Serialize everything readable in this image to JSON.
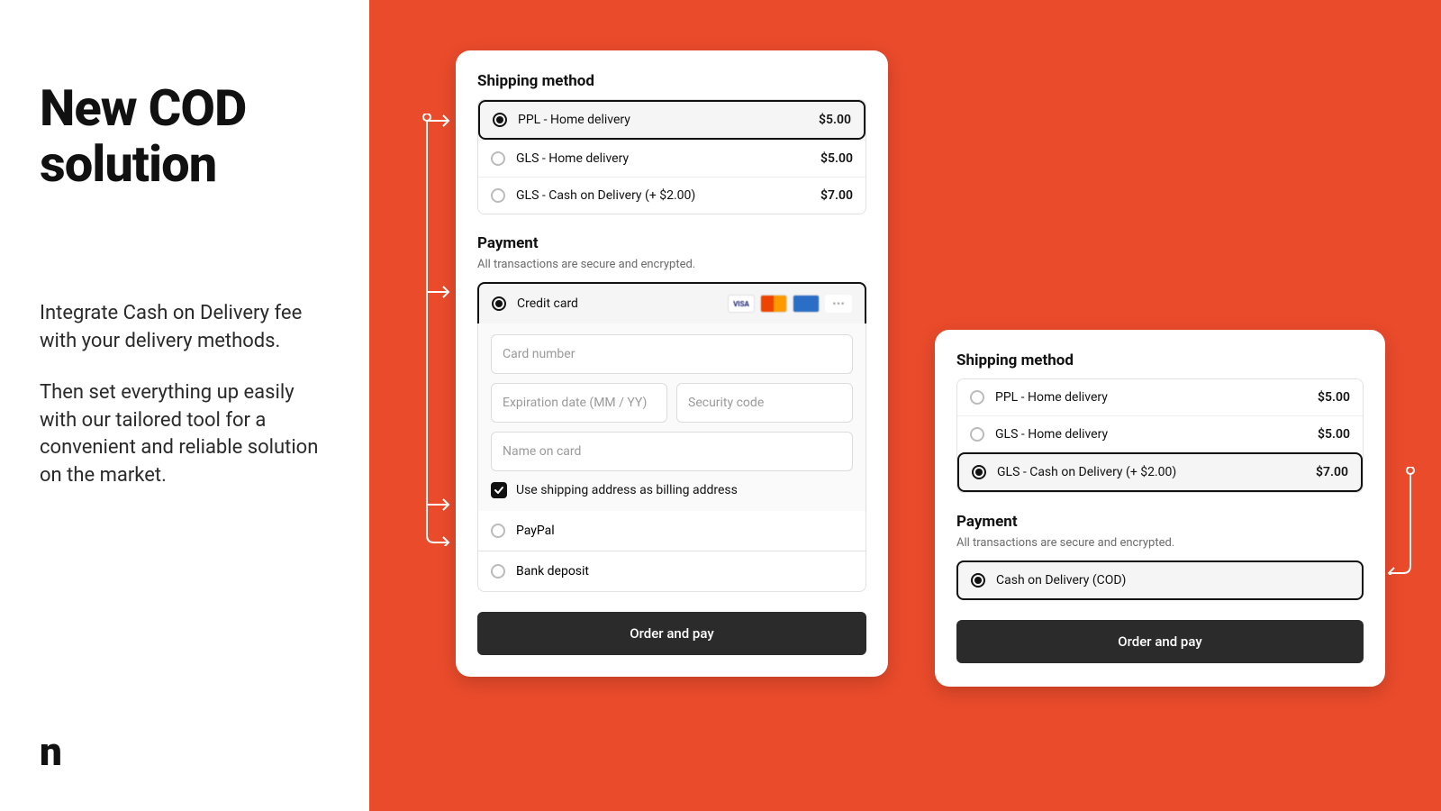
{
  "hero": {
    "title": "New COD solution",
    "p1": "Integrate Cash on Delivery fee with your delivery methods.",
    "p2": "Then set everything up easily with our tailored tool for a convenient and reliable solution on the market."
  },
  "logo": "n",
  "checkout_a": {
    "shipping_title": "Shipping method",
    "options": [
      {
        "label": "PPL - Home delivery",
        "price": "$5.00",
        "selected": true
      },
      {
        "label": "GLS - Home delivery",
        "price": "$5.00",
        "selected": false
      },
      {
        "label": "GLS - Cash on Delivery (+ $2.00)",
        "price": "$7.00",
        "selected": false
      }
    ],
    "payment_title": "Payment",
    "payment_sub": "All transactions are secure and encrypted.",
    "credit_card_label": "Credit card",
    "card_number_ph": "Card number",
    "exp_ph": "Expiration date (MM / YY)",
    "sec_ph": "Security code",
    "name_ph": "Name on card",
    "billing_chk": "Use shipping address as billing address",
    "alt1": "PayPal",
    "alt2": "Bank deposit",
    "submit": "Order and pay"
  },
  "checkout_b": {
    "shipping_title": "Shipping method",
    "options": [
      {
        "label": "PPL - Home delivery",
        "price": "$5.00",
        "selected": false
      },
      {
        "label": "GLS - Home delivery",
        "price": "$5.00",
        "selected": false
      },
      {
        "label": "GLS - Cash on Delivery (+ $2.00)",
        "price": "$7.00",
        "selected": true
      }
    ],
    "payment_title": "Payment",
    "payment_sub": "All transactions are secure and encrypted.",
    "cod_label": "Cash on Delivery (COD)",
    "submit": "Order and pay"
  }
}
